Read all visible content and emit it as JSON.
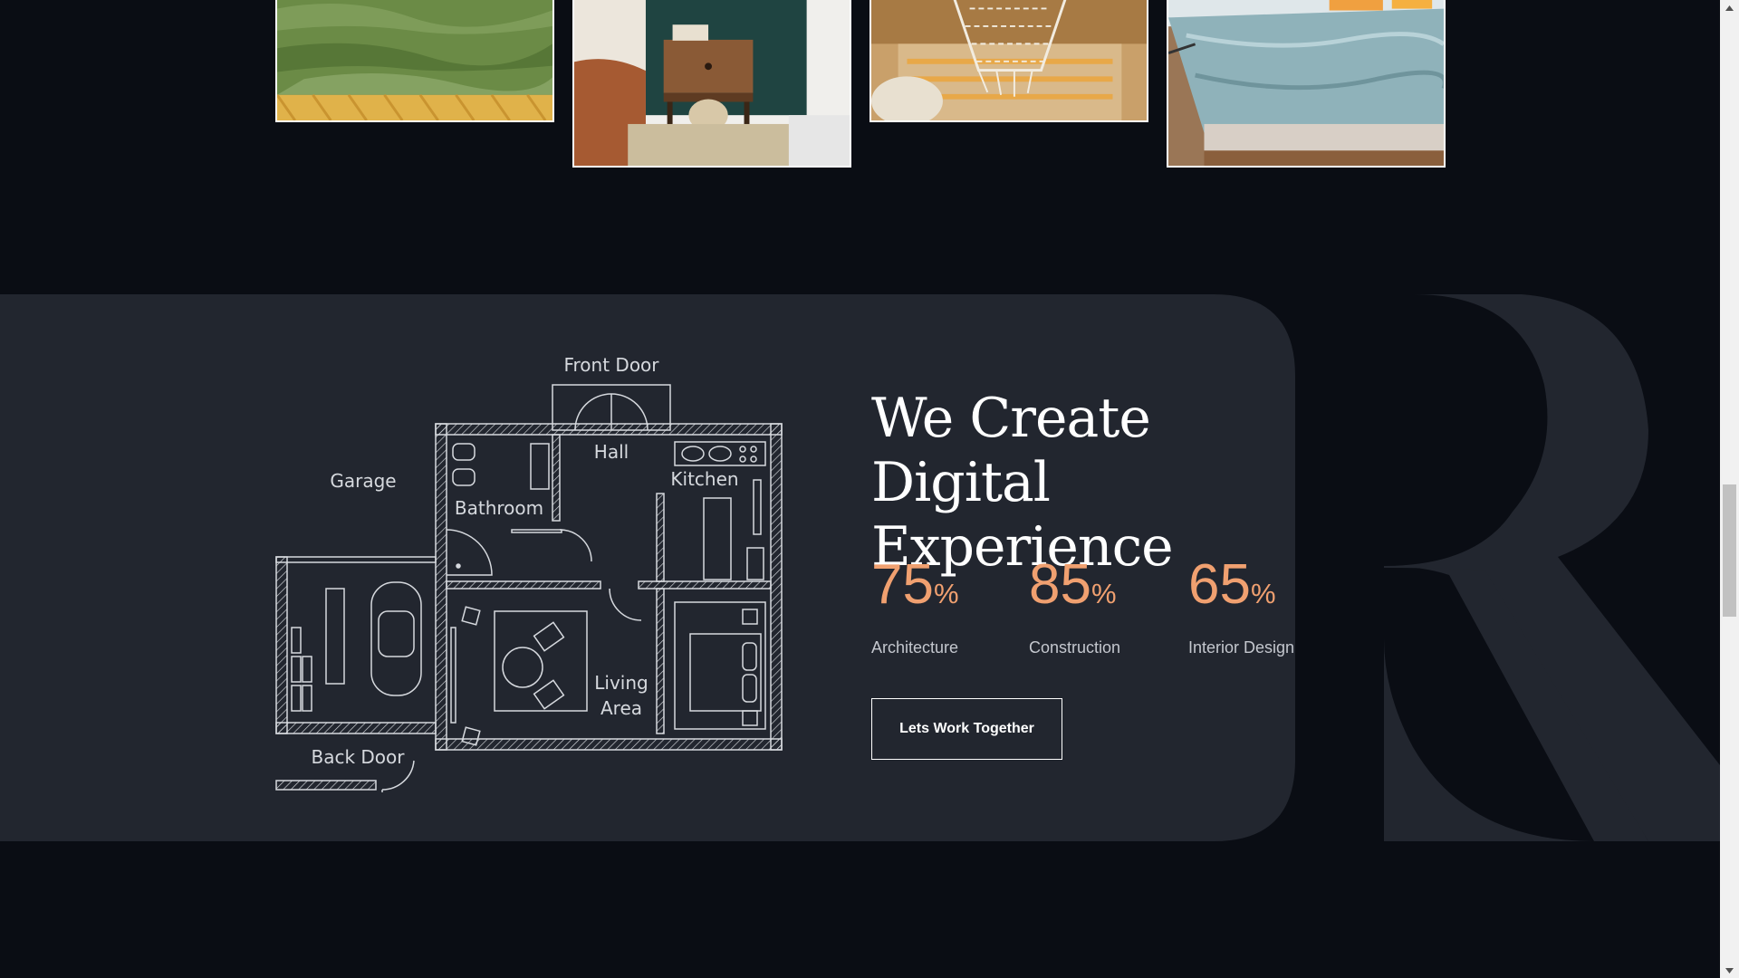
{
  "gallery": {
    "images": [
      {
        "subject": "green-shag-rug"
      },
      {
        "subject": "bedside-nightstand"
      },
      {
        "subject": "hammock-chair-rug"
      },
      {
        "subject": "bed-with-blue-throw"
      }
    ]
  },
  "floor_plan": {
    "labels": {
      "front_door": "Front Door",
      "hall": "Hall",
      "kitchen": "Kitchen",
      "garage": "Garage",
      "bathroom": "Bathroom",
      "back_door": "Back Door",
      "living": "Living",
      "area": "Area"
    }
  },
  "hero": {
    "headline_line1": "We Create Digital",
    "headline_line2": "Experience",
    "watermark": "R"
  },
  "stats": [
    {
      "value": "75",
      "unit": "%",
      "label": "Architecture"
    },
    {
      "value": "85",
      "unit": "%",
      "label": "Construction"
    },
    {
      "value": "65",
      "unit": "%",
      "label": "Interior Design"
    }
  ],
  "cta": {
    "label": "Lets Work Together"
  },
  "colors": {
    "background": "#0a0d14",
    "band": "#22262f",
    "accent": "#f0a070",
    "text": "#ffffff"
  },
  "scrollbar": {
    "position": 0.5
  }
}
